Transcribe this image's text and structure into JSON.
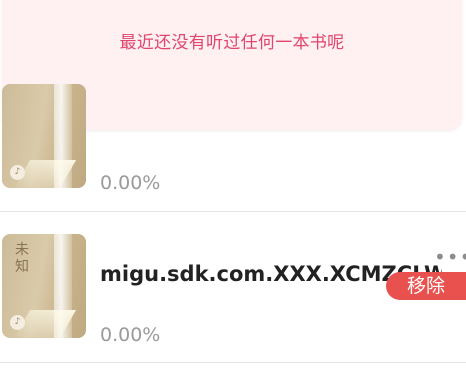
{
  "empty_state": {
    "message": "最近还没有听过任何一本书呢"
  },
  "books": [
    {
      "cover_title": "",
      "title": "",
      "progress": "0.00%"
    },
    {
      "cover_title": "未知",
      "title": "migu.sdk.com.XXX.XCMZCLWZ",
      "progress": "0.00%",
      "more_icon": "more-dots-icon",
      "remove_label": "移除"
    }
  ],
  "colors": {
    "banner_bg": "#fff0f1",
    "empty_text": "#e0456d",
    "remove_bg": "#e8514d"
  }
}
